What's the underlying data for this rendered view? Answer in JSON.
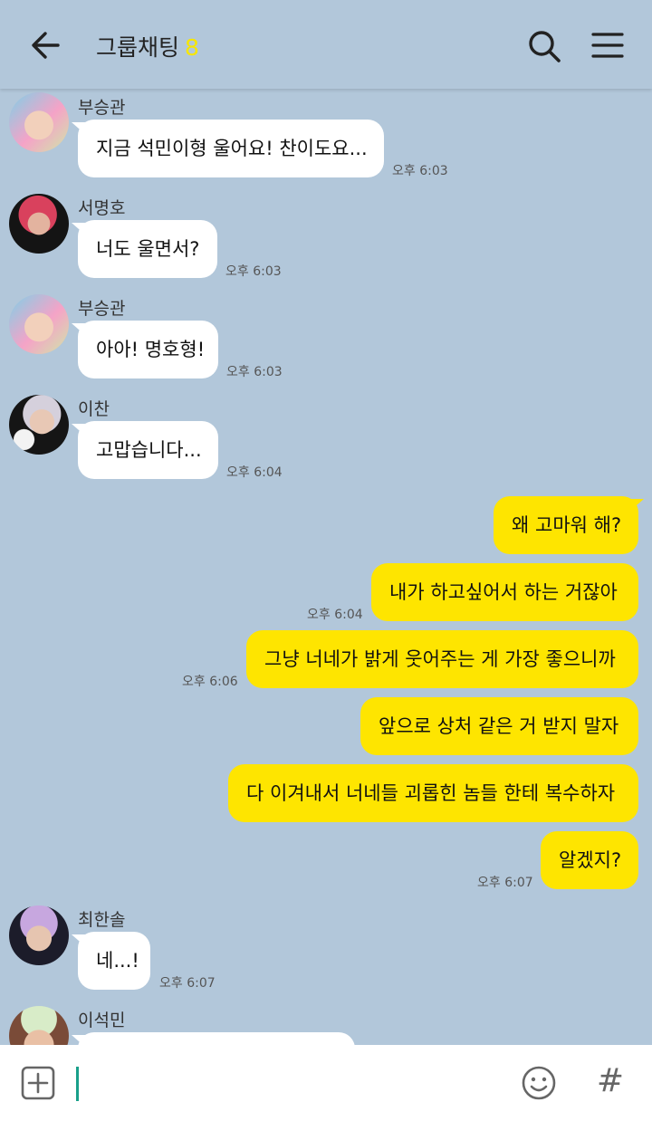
{
  "header": {
    "title": "그룹채팅",
    "member_count": "8",
    "icons": [
      "back-arrow-icon",
      "search-icon",
      "menu-icon"
    ]
  },
  "messages": [
    {
      "sender": "부승관",
      "text": "지금 석민이형 울어요! 찬이도요...",
      "time": "오후 6:03",
      "mine": false
    },
    {
      "sender": "서명호",
      "text": "너도 울면서?",
      "time": "오후 6:03",
      "mine": false
    },
    {
      "sender": "부승관",
      "text": "아아! 명호형!",
      "time": "오후 6:03",
      "mine": false
    },
    {
      "sender": "이찬",
      "text": "고맙습니다...",
      "time": "오후 6:04",
      "mine": false
    },
    {
      "text": "왜 고마워 해?",
      "time": "",
      "mine": true
    },
    {
      "text": "내가 하고싶어서 하는 거잖아",
      "time": "오후 6:04",
      "mine": true
    },
    {
      "text": "그냥 너네가 밝게 웃어주는 게 가장 좋으니까",
      "time": "오후 6:06",
      "mine": true
    },
    {
      "text": "앞으로 상처 같은 거 받지 말자",
      "time": "",
      "mine": true
    },
    {
      "text": "다 이겨내서 너네들 괴롭힌 놈들 한테 복수하자",
      "time": "",
      "mine": true
    },
    {
      "text": "알겠지?",
      "time": "오후 6:07",
      "mine": true
    },
    {
      "sender": "최한솔",
      "text": "네...!",
      "time": "오후 6:07",
      "mine": false
    },
    {
      "sender": "이석민",
      "text": "",
      "time": "",
      "mine": false
    }
  ],
  "input_bar": {
    "icons": [
      "plus-icon",
      "emoji-icon",
      "hashtag-icon"
    ],
    "hash_symbol": "#",
    "value": ""
  },
  "colors": {
    "background": "#b2c7da",
    "my_bubble": "#fee500",
    "other_bubble": "#ffffff",
    "member_count": "#f7e600",
    "cursor": "#19a08a"
  }
}
